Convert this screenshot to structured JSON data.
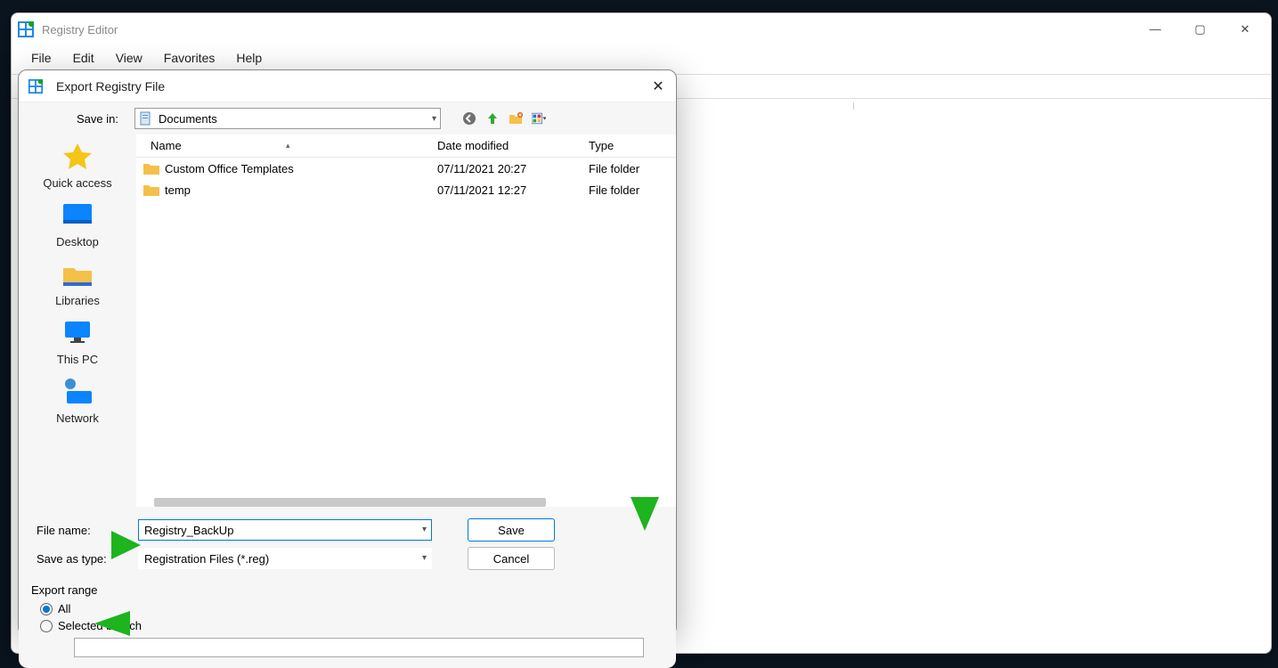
{
  "main_window": {
    "title": "Registry Editor",
    "menus": [
      "File",
      "Edit",
      "View",
      "Favorites",
      "Help"
    ],
    "win_controls": {
      "min": "—",
      "max": "▢",
      "close": "✕"
    }
  },
  "dialog": {
    "title": "Export Registry File",
    "close": "✕",
    "save_in_label": "Save in:",
    "save_in_value": "Documents",
    "columns": {
      "name": "Name",
      "date": "Date modified",
      "type": "Type"
    },
    "rows": [
      {
        "name": "Custom Office Templates",
        "date": "07/11/2021 20:27",
        "type": "File folder"
      },
      {
        "name": "temp",
        "date": "07/11/2021 12:27",
        "type": "File folder"
      }
    ],
    "sidebar": [
      {
        "key": "quick",
        "label": "Quick access"
      },
      {
        "key": "desktop",
        "label": "Desktop"
      },
      {
        "key": "libraries",
        "label": "Libraries"
      },
      {
        "key": "thispc",
        "label": "This PC"
      },
      {
        "key": "network",
        "label": "Network"
      }
    ],
    "file_name_label": "File name:",
    "file_name_value": "Registry_BackUp",
    "save_as_type_label": "Save as type:",
    "save_as_type_value": "Registration Files (*.reg)",
    "save_btn": "Save",
    "cancel_btn": "Cancel",
    "export_range_legend": "Export range",
    "radio_all": "All",
    "radio_selected": "Selected branch"
  }
}
